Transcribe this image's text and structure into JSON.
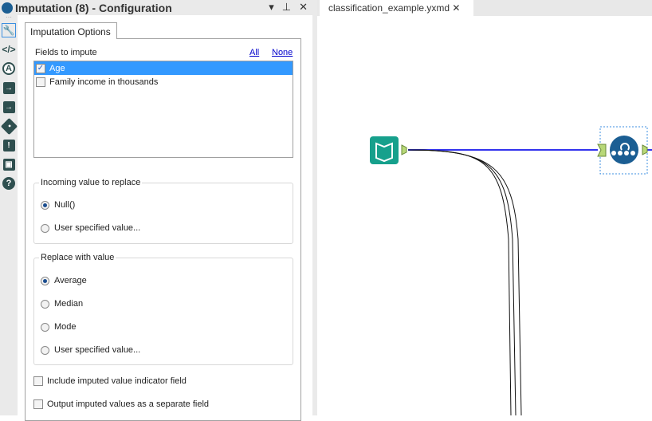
{
  "window": {
    "title": "Imputation (8) - Configuration",
    "controls": {
      "dropdown": "▾",
      "pin": "⊥",
      "close": "✕"
    }
  },
  "sidebar": {
    "icons": [
      "wrench-icon",
      "code-icon",
      "compass-icon",
      "input-icon",
      "output-icon",
      "tag-icon",
      "alert-icon",
      "box-icon",
      "help-icon"
    ]
  },
  "config": {
    "tab": "Imputation Options",
    "fields_label": "Fields to impute",
    "all": "All",
    "none": "None",
    "fields": [
      {
        "name": "Age",
        "checked": true,
        "selected": true
      },
      {
        "name": "Family income in thousands",
        "checked": false,
        "selected": false
      }
    ],
    "incoming": {
      "title": "Incoming value to replace",
      "options": [
        {
          "label": "Null()",
          "selected": true
        },
        {
          "label": "User specified value...",
          "selected": false
        }
      ]
    },
    "replace": {
      "title": "Replace with value",
      "options": [
        {
          "label": "Average",
          "selected": true
        },
        {
          "label": "Median",
          "selected": false
        },
        {
          "label": "Mode",
          "selected": false
        },
        {
          "label": "User specified value...",
          "selected": false
        }
      ]
    },
    "indicator": {
      "label": "Include imputed value indicator field",
      "checked": false
    },
    "separate": {
      "label": "Output imputed values as a separate field",
      "checked": false
    }
  },
  "canvas": {
    "tab": "classification_example.yxmd",
    "tab_close": "✕",
    "link_color": "#3333ee",
    "input_color": "#16a08c",
    "tool_color": "#1b5e93"
  }
}
